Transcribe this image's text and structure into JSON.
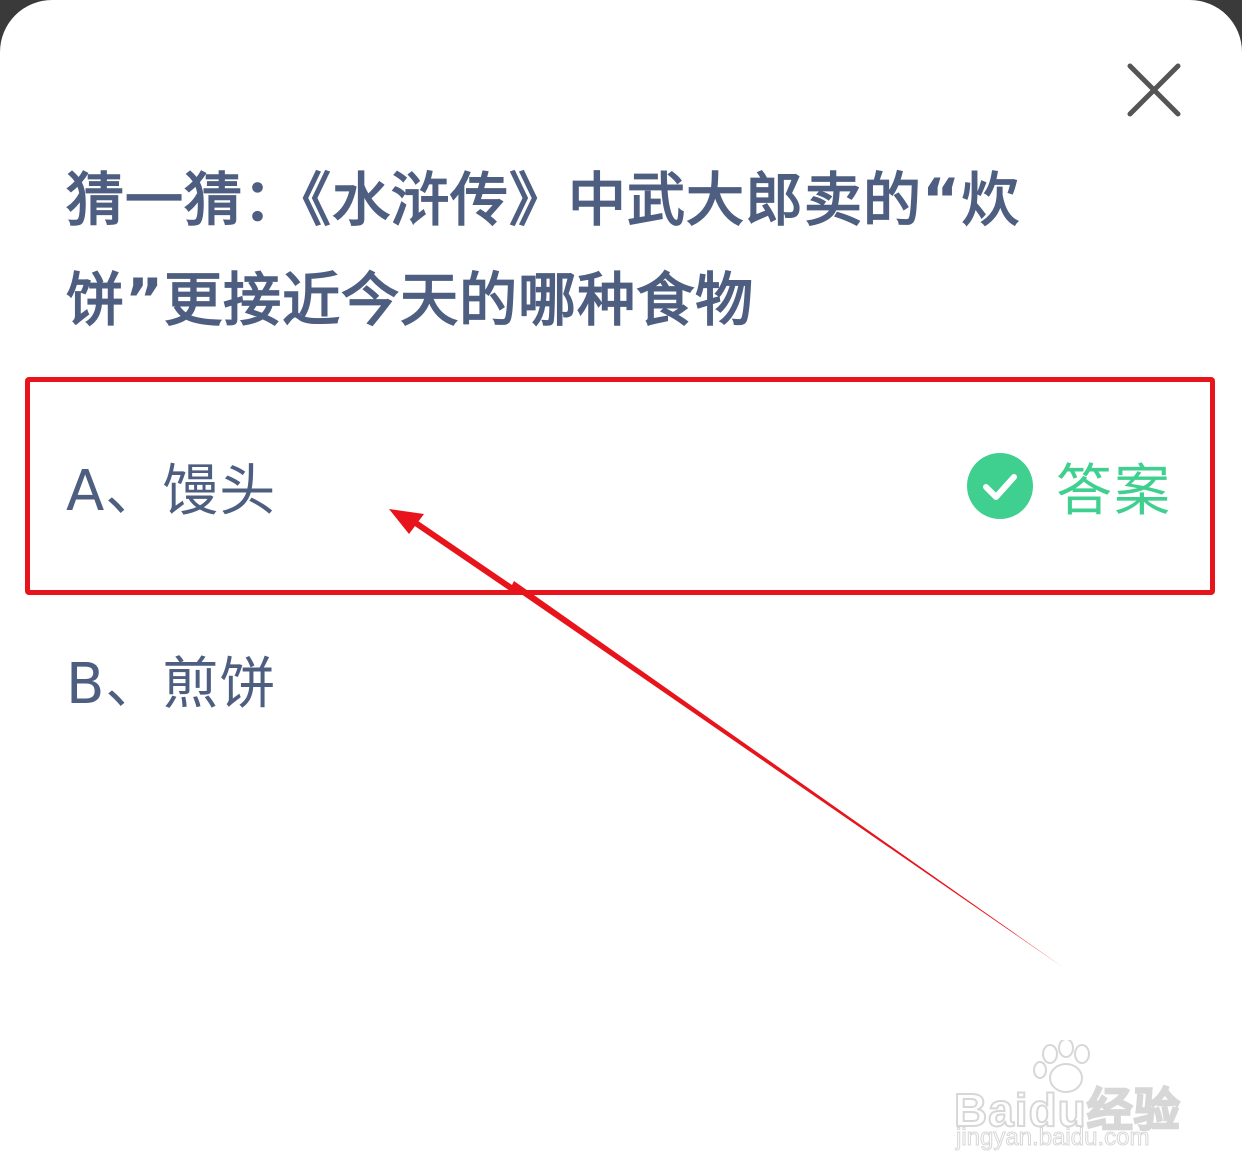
{
  "dialog": {
    "question": "猜一猜：《水浒传》中武大郎卖的“炊饼”更接近今天的哪种食物",
    "close_icon": "close-icon"
  },
  "options": [
    {
      "label": "A、馒头",
      "is_answer": true,
      "answer_label": "答案",
      "answer_icon": "check-circle-icon"
    },
    {
      "label": "B、煎饼",
      "is_answer": false
    }
  ],
  "colors": {
    "question_text": "#4e5e80",
    "answer_green": "#3fcf8e",
    "annotation_red": "#e8141b"
  },
  "watermark": {
    "brand": "Baidu经验",
    "url": "jingyan.baidu.com"
  }
}
